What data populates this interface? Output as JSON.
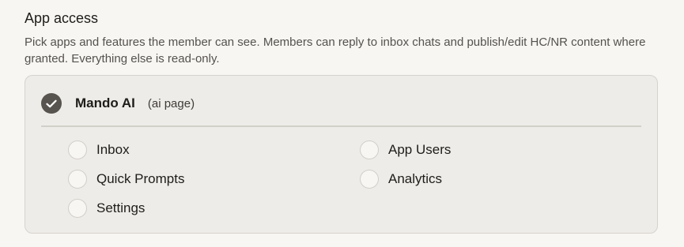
{
  "section": {
    "title": "App access",
    "description": "Pick apps and features the member can see. Members can reply to inbox chats and publish/edit HC/NR content where granted. Everything else is read-only."
  },
  "app": {
    "name": "Mando AI",
    "tag": "(ai page)",
    "checked": true,
    "icon": "check-icon",
    "accent_color": "#57534e"
  },
  "features": {
    "left": [
      {
        "label": "Inbox",
        "checked": false
      },
      {
        "label": "Quick Prompts",
        "checked": false
      },
      {
        "label": "Settings",
        "checked": false
      }
    ],
    "right": [
      {
        "label": "App Users",
        "checked": false
      },
      {
        "label": "Analytics",
        "checked": false
      }
    ]
  }
}
